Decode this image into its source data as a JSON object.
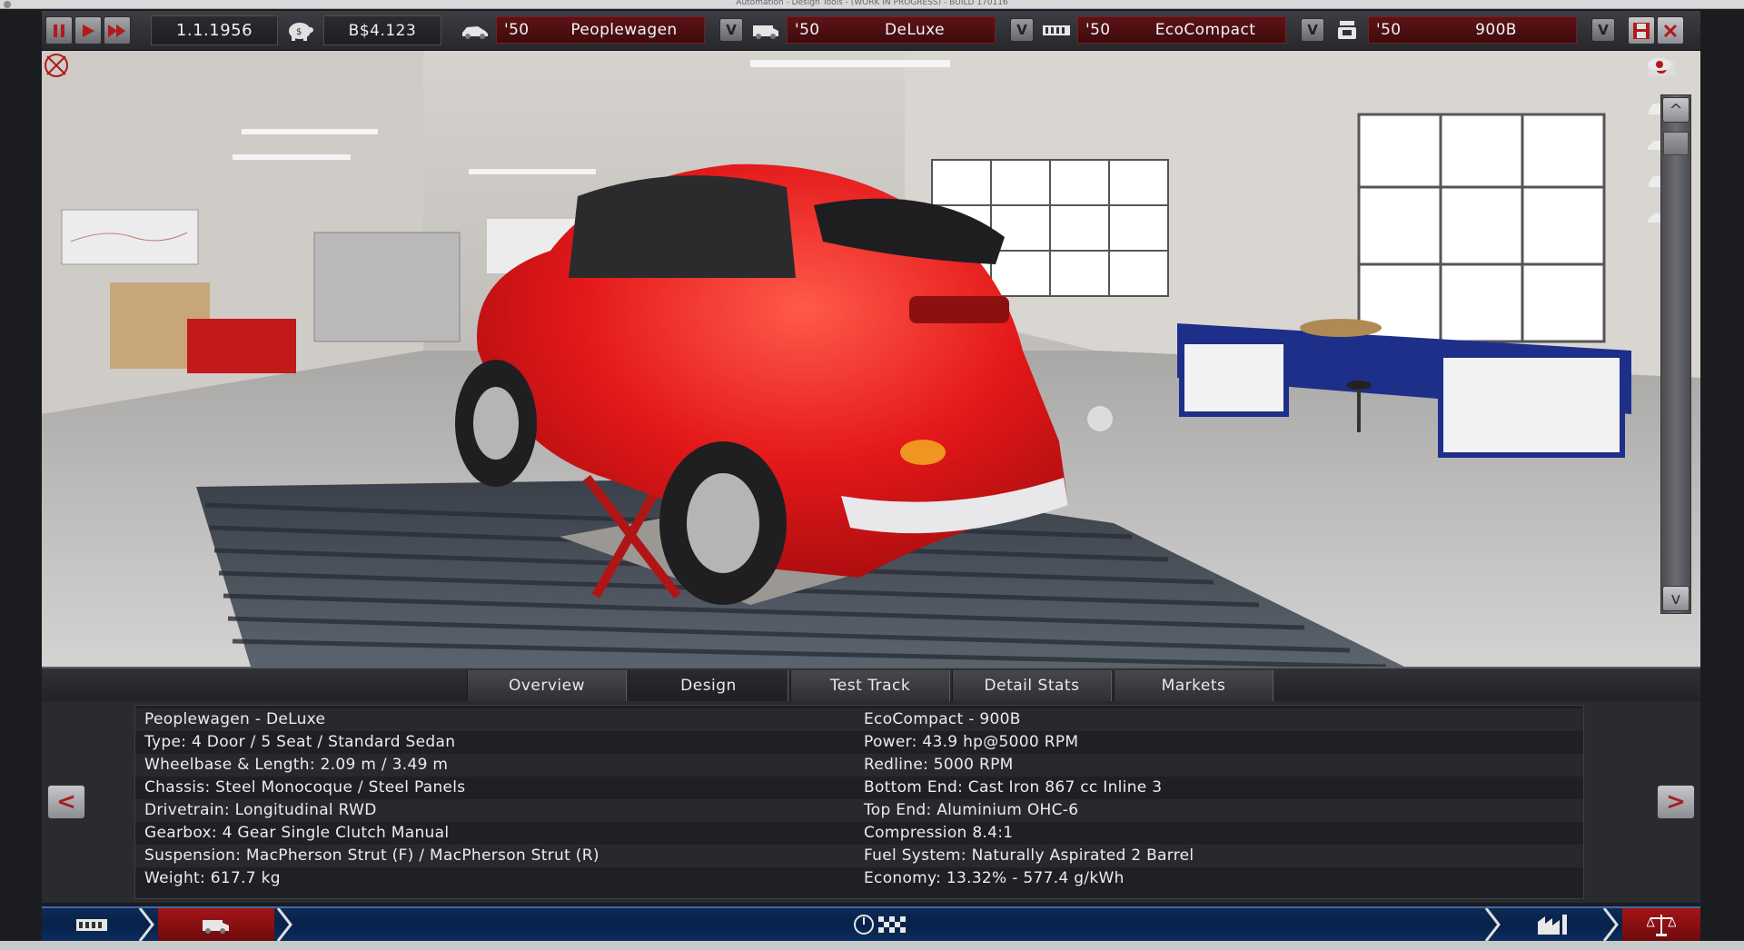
{
  "window": {
    "title": "Automation - Design Tools - (WORK IN PROGRESS) - BUILD 170116"
  },
  "topbar": {
    "date": "1.1.1956",
    "money": "B$4.123",
    "selectors": [
      {
        "icon": "car-chassis-icon",
        "year": "'50",
        "name": "Peoplewagen"
      },
      {
        "icon": "car-trim-icon",
        "year": "'50",
        "name": "DeLuxe"
      },
      {
        "icon": "engine-family-icon",
        "year": "'50",
        "name": "EcoCompact"
      },
      {
        "icon": "engine-variant-icon",
        "year": "'50",
        "name": "900B"
      }
    ],
    "dropdown_glyph": "V"
  },
  "tabs": [
    {
      "label": "Overview",
      "active": false
    },
    {
      "label": "Design",
      "active": true
    },
    {
      "label": "Test Track",
      "active": false
    },
    {
      "label": "Detail Stats",
      "active": false
    },
    {
      "label": "Markets",
      "active": false
    }
  ],
  "stats": {
    "car": [
      "Peoplewagen - DeLuxe",
      "Type: 4 Door / 5 Seat / Standard Sedan",
      "Wheelbase & Length: 2.09 m / 3.49 m",
      "Chassis: Steel Monocoque / Steel Panels",
      "Drivetrain: Longitudinal RWD",
      "Gearbox: 4 Gear Single Clutch Manual",
      "Suspension: MacPherson Strut (F) / MacPherson Strut (R)",
      "Weight: 617.7 kg"
    ],
    "engine": [
      "EcoCompact - 900B",
      "Power: 43.9 hp@5000 RPM",
      "Redline: 5000 RPM",
      "Bottom End: Cast Iron 867 cc Inline 3",
      "Top End: Aluminium OHC-6",
      "Compression 8.4:1",
      "Fuel System: Naturally Aspirated 2 Barrel",
      "Economy: 13.32% - 577.4 g/kWh"
    ]
  },
  "nav": {
    "prev": "<",
    "next": ">"
  },
  "scroll": {
    "up": "^",
    "down": "v"
  },
  "colors": {
    "car": "#e11d1d",
    "accent_red": "#a51416",
    "bottom_blue": "#06214a"
  }
}
